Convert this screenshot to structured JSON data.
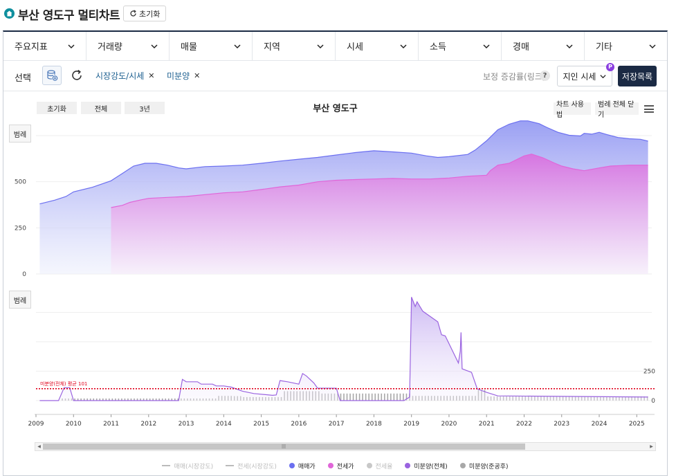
{
  "header": {
    "title": "부산 영도구 멀티차트",
    "reset_label": "초기화"
  },
  "categories": [
    "주요지표",
    "거래량",
    "매물",
    "지역",
    "시세",
    "소득",
    "경매",
    "기타"
  ],
  "selection": {
    "label": "선택",
    "chips": [
      "시장강도/시세",
      "미분양"
    ],
    "adjust_label": "보정 증감률(링크)",
    "price_select": "지인 시세",
    "price_badge": "P",
    "save_label": "저장목록"
  },
  "controls": {
    "reset": "초기화",
    "all": "전체",
    "three_year": "3년",
    "usage": "차트 사용법",
    "close_legend": "범례 전체 닫기",
    "legend": "범례"
  },
  "colors": {
    "sale": "#6b6ff0",
    "jeonse": "#e066d8",
    "unsold": "#9a63e0",
    "unsold_done": "#a8a8a8",
    "avg": "#e0001a"
  },
  "chart_data": {
    "type": "area",
    "title": "부산 영도구",
    "x_range": [
      2009.0,
      2025.4
    ],
    "xticks": [
      "2009",
      "2010",
      "2011",
      "2012",
      "2013",
      "2014",
      "2015",
      "2016",
      "2017",
      "2018",
      "2019",
      "2020",
      "2021",
      "2022",
      "2023",
      "2024",
      "2025"
    ],
    "upper": {
      "yticks": [
        0,
        250,
        500
      ],
      "ylim": [
        0,
        750
      ],
      "series": [
        {
          "name": "매매가",
          "x": [
            2009.1,
            2009.5,
            2009.8,
            2010.0,
            2010.5,
            2011.0,
            2011.3,
            2011.6,
            2011.9,
            2012.2,
            2012.5,
            2012.8,
            2013.0,
            2013.5,
            2014.0,
            2014.5,
            2015.0,
            2015.5,
            2016.0,
            2016.5,
            2017.0,
            2017.5,
            2018.0,
            2018.5,
            2019.0,
            2019.4,
            2019.7,
            2020.0,
            2020.5,
            2020.7,
            2021.0,
            2021.3,
            2021.6,
            2021.9,
            2022.1,
            2022.4,
            2022.6,
            2022.9,
            2023.2,
            2023.5,
            2023.6,
            2023.8,
            2024.0,
            2024.2,
            2024.5,
            2024.8,
            2025.1,
            2025.3
          ],
          "values": [
            380,
            400,
            420,
            445,
            470,
            505,
            545,
            585,
            600,
            600,
            590,
            575,
            570,
            582,
            585,
            590,
            600,
            612,
            622,
            632,
            645,
            658,
            668,
            662,
            655,
            640,
            632,
            636,
            648,
            672,
            722,
            782,
            812,
            830,
            830,
            815,
            795,
            768,
            752,
            748,
            762,
            758,
            768,
            756,
            740,
            733,
            730,
            720
          ]
        },
        {
          "name": "전세가",
          "x": [
            2011.0,
            2011.3,
            2011.5,
            2011.8,
            2012.0,
            2012.5,
            2013.0,
            2013.5,
            2014.0,
            2014.5,
            2015.0,
            2015.5,
            2016.0,
            2016.5,
            2017.0,
            2017.5,
            2018.0,
            2018.5,
            2019.0,
            2019.5,
            2020.0,
            2020.5,
            2021.0,
            2021.1,
            2021.3,
            2021.6,
            2022.0,
            2022.2,
            2022.5,
            2022.8,
            2023.0,
            2023.3,
            2023.6,
            2024.0,
            2024.3,
            2024.8,
            2025.3
          ],
          "values": [
            360,
            372,
            388,
            402,
            410,
            415,
            420,
            430,
            440,
            445,
            458,
            472,
            482,
            500,
            508,
            512,
            515,
            518,
            515,
            515,
            520,
            530,
            535,
            560,
            590,
            600,
            640,
            650,
            630,
            602,
            585,
            570,
            560,
            575,
            585,
            590,
            590
          ]
        }
      ]
    },
    "lower": {
      "yticks": [
        0,
        250
      ],
      "ylim": [
        0,
        900
      ],
      "average_line": {
        "value": 101,
        "label": "미분양(전체) 평균 101"
      },
      "series": [
        {
          "name": "미분양(전체)",
          "x": [
            2009.1,
            2009.6,
            2009.75,
            2009.9,
            2010.0,
            2012.8,
            2012.9,
            2013.0,
            2013.3,
            2013.4,
            2013.7,
            2013.8,
            2014.0,
            2014.2,
            2014.5,
            2014.8,
            2015.3,
            2015.4,
            2015.5,
            2015.7,
            2016.0,
            2016.1,
            2016.2,
            2016.4,
            2016.5,
            2017.0,
            2017.1,
            2018.8,
            2018.95,
            2019.0,
            2019.1,
            2019.15,
            2019.3,
            2019.7,
            2019.8,
            2019.9,
            2020.25,
            2020.3,
            2020.32,
            2020.35,
            2020.6,
            2020.75,
            2021.0,
            2021.3,
            2025.3
          ],
          "values": [
            0,
            0,
            110,
            110,
            0,
            0,
            180,
            160,
            160,
            140,
            140,
            125,
            125,
            115,
            80,
            60,
            45,
            48,
            170,
            160,
            140,
            230,
            210,
            150,
            105,
            105,
            0,
            0,
            30,
            880,
            800,
            840,
            760,
            670,
            560,
            550,
            320,
            420,
            580,
            270,
            240,
            100,
            70,
            40,
            30
          ]
        },
        {
          "name": "미분양(준공후)",
          "x": [
            2009.7,
            2009.75,
            2013.85,
            2014.2,
            2014.5,
            2015.4,
            2015.55,
            2015.6,
            2016.5,
            2016.6,
            2017.0,
            2019.0,
            2020.6,
            2020.7,
            2020.8,
            2021.0,
            2025.3
          ],
          "values": [
            18,
            18,
            40,
            38,
            30,
            30,
            115,
            80,
            80,
            60,
            60,
            40,
            40,
            90,
            90,
            35,
            35
          ]
        }
      ]
    },
    "legend": [
      {
        "name": "매매(시장강도)",
        "active": false,
        "marker": "line"
      },
      {
        "name": "전세(시장강도)",
        "active": false,
        "marker": "line"
      },
      {
        "name": "매매가",
        "active": true,
        "marker": "dot"
      },
      {
        "name": "전세가",
        "active": true,
        "marker": "dot"
      },
      {
        "name": "전세율",
        "active": false,
        "marker": "dot"
      },
      {
        "name": "미분양(전체)",
        "active": true,
        "marker": "dot"
      },
      {
        "name": "미분양(준공후)",
        "active": true,
        "marker": "dot"
      }
    ]
  }
}
